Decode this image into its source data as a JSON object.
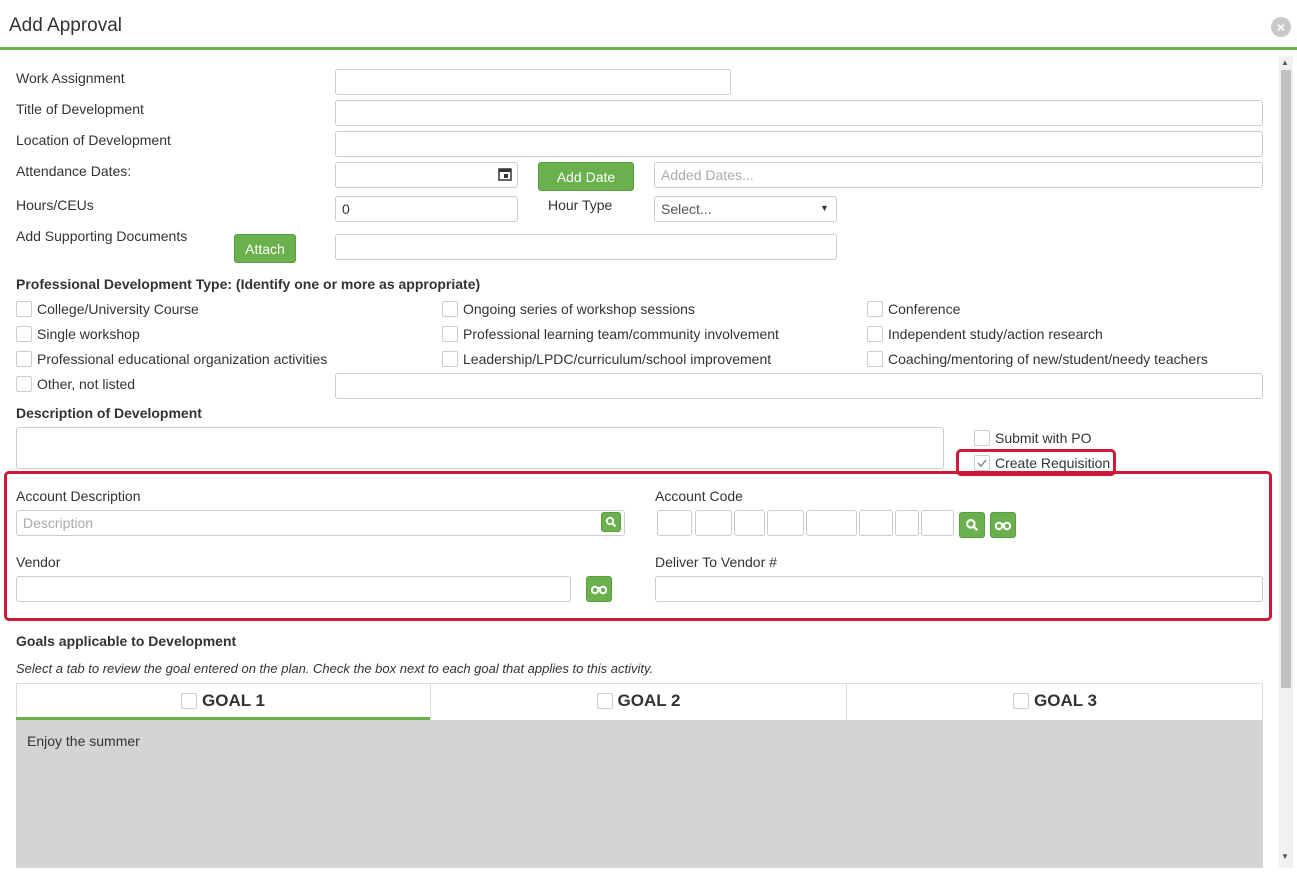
{
  "dialog": {
    "title": "Add Approval",
    "close_symbol": "×"
  },
  "form": {
    "work_assignment_label": "Work Assignment",
    "title_label": "Title of Development",
    "location_label": "Location of Development",
    "attendance_label": "Attendance Dates:",
    "add_date_button": "Add Date",
    "added_dates_placeholder": "Added Dates...",
    "hours_label": "Hours/CEUs",
    "hours_value": "0",
    "hour_type_label": "Hour Type",
    "hour_type_selected": "Select...",
    "supporting_docs_label": "Add Supporting Documents",
    "attach_button": "Attach"
  },
  "pd_type": {
    "heading": "Professional Development Type: (Identify one or more as appropriate)",
    "options": [
      "College/University Course",
      "Ongoing series of workshop sessions",
      "Conference",
      "Single workshop",
      "Professional learning team/community involvement",
      "Independent study/action research",
      "Professional educational organization activities",
      "Leadership/LPDC/curriculum/school improvement",
      "Coaching/mentoring of new/student/needy teachers",
      "Other, not listed"
    ]
  },
  "description": {
    "heading": "Description of Development",
    "submit_po_label": "Submit with PO",
    "create_requisition_label": "Create Requisition",
    "create_requisition_checked": true
  },
  "account": {
    "desc_label": "Account Description",
    "desc_placeholder": "Description",
    "code_label": "Account Code",
    "vendor_label": "Vendor",
    "deliver_label": "Deliver To Vendor #"
  },
  "goals": {
    "heading": "Goals applicable to Development",
    "instructions": "Select a tab to review the goal entered on the plan. Check the box next to each goal that applies to this activity.",
    "tabs": [
      "GOAL 1",
      "GOAL 2",
      "GOAL 3"
    ],
    "active_tab": "GOAL 1",
    "goal_text": "Enjoy the summer"
  },
  "colors": {
    "accent_green": "#6ab04c",
    "highlight_red": "#cc1a3a"
  },
  "icons": {
    "search": "magnifier",
    "lookup": "binoculars",
    "calendar": "calendar",
    "dropdown": "caret-down"
  }
}
